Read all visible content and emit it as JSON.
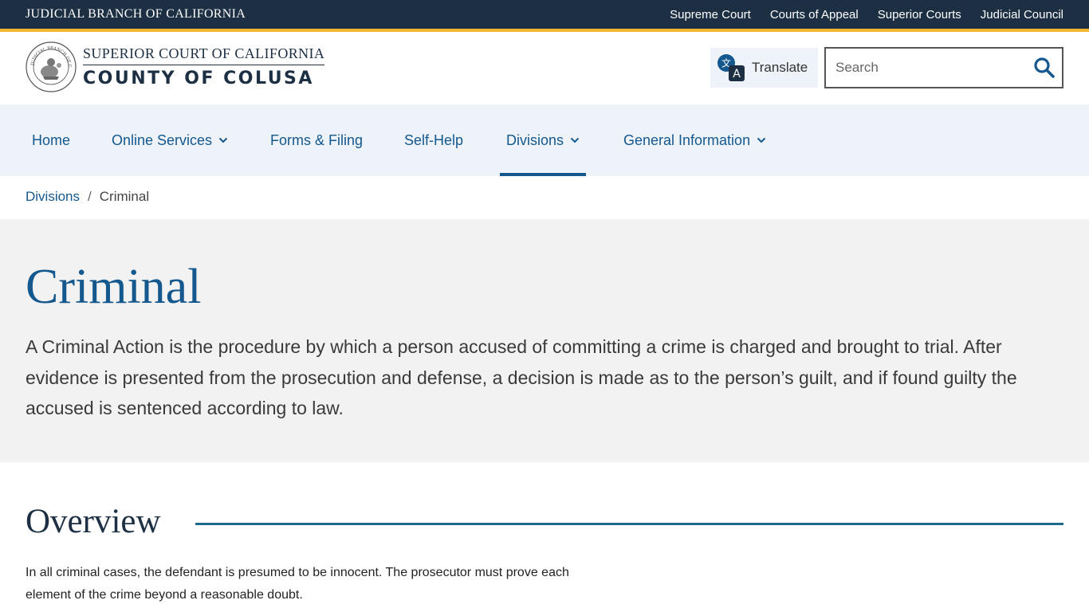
{
  "topbar": {
    "title": "JUDICIAL BRANCH OF CALIFORNIA",
    "links": [
      "Supreme Court",
      "Courts of Appeal",
      "Superior Courts",
      "Judicial Council"
    ]
  },
  "header": {
    "seal_text": "JUDICIAL BRANCH OF CALIFORNIA",
    "court_line1": "SUPERIOR COURT OF CALIFORNIA",
    "court_line2": "COUNTY OF COLUSA",
    "translate_label": "Translate",
    "search_placeholder": "Search"
  },
  "nav": {
    "items": [
      {
        "label": "Home",
        "has_dropdown": false
      },
      {
        "label": "Online Services",
        "has_dropdown": true
      },
      {
        "label": "Forms & Filing",
        "has_dropdown": false
      },
      {
        "label": "Self-Help",
        "has_dropdown": false
      },
      {
        "label": "Divisions",
        "has_dropdown": true,
        "active": true
      },
      {
        "label": "General Information",
        "has_dropdown": true
      }
    ]
  },
  "breadcrumb": {
    "parent": "Divisions",
    "separator": "/",
    "current": "Criminal"
  },
  "hero": {
    "title": "Criminal",
    "description": "A Criminal Action is the procedure by which a person accused of committing a crime is charged and brought to trial. After evidence is presented from the prosecution and defense, a decision is made as to the person’s guilt, and if found guilty the accused is sentenced according to law."
  },
  "overview": {
    "title": "Overview",
    "text": "In all criminal cases, the defendant is presumed to be innocent. The prosecutor must prove each element of the crime beyond a reasonable doubt."
  },
  "colors": {
    "topbar_bg": "#1c2f43",
    "gold_accent": "#f2b632",
    "link_blue": "#14588e",
    "nav_bg": "#eef3f9",
    "hero_bg": "#f2f2f2"
  }
}
